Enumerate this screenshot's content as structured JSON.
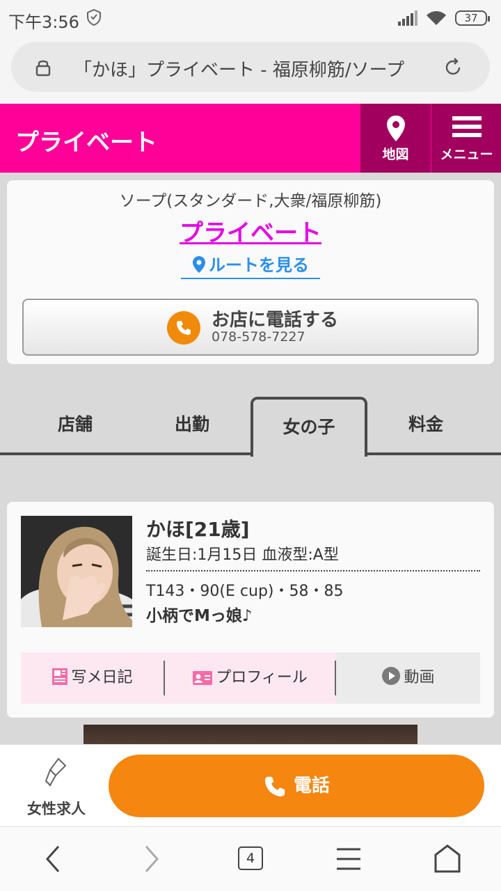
{
  "status_bar": {
    "time": "下午3:56",
    "battery": "37"
  },
  "browser": {
    "url_text": "「かほ」プライベート - 福原柳筋/ソープ｜",
    "tab_count": "4"
  },
  "header": {
    "brand": "プライベート",
    "map_label": "地図",
    "menu_label": "メニュー"
  },
  "shop": {
    "category": "ソープ(スタンダード,大衆/福原柳筋)",
    "name": "プライベート",
    "route_label": "ルートを見る",
    "call_label": "お店に電話する",
    "phone": "078-578-7227"
  },
  "tabs": [
    {
      "label": "店舗"
    },
    {
      "label": "出勤"
    },
    {
      "label": "女の子"
    },
    {
      "label": "料金"
    }
  ],
  "girl": {
    "name_age": "かほ[21歳]",
    "birth_blood": "誕生日:1月15日 血液型:A型",
    "sizes": "T143・90(E cup)・58・85",
    "catch": "小柄でMっ娘♪",
    "links": {
      "diary": "写メ日記",
      "profile": "プロフィール",
      "video": "動画"
    }
  },
  "bottom": {
    "recruit_label": "女性求人",
    "tel_label": "電話"
  },
  "colors": {
    "brand_pink": "#ff0099",
    "header_dark": "#a1005e",
    "orange": "#f5860f",
    "route_blue": "#2a8fe8"
  }
}
